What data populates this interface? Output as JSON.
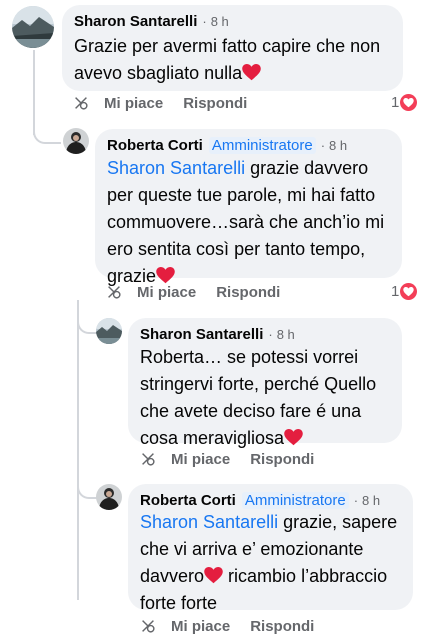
{
  "comments": [
    {
      "author": "Sharon Santarelli",
      "badge": "",
      "time": "8 h",
      "text": "Grazie per avermi fatto capire che non avevo sbagliato nulla",
      "actions": {
        "like": "Mi piace",
        "reply": "Rispondi"
      },
      "reactions": "1",
      "avatar_icon": "landscape-photo-avatar"
    },
    {
      "author": "Roberta Corti",
      "badge": "Amministratore",
      "time": "8 h",
      "mention": "Sharon Santarelli",
      "text": " grazie davvero per queste tue parole, mi hai fatto commuovere…sarà che anch’io mi ero sentita così per tanto tempo, grazie",
      "actions": {
        "like": "Mi piace",
        "reply": "Rispondi"
      },
      "reactions": "1",
      "avatar_icon": "person-photo-avatar"
    },
    {
      "author": "Sharon Santarelli",
      "badge": "",
      "time": "8 h",
      "text": "Roberta… se potessi vorrei stringervi forte, perché Quello che avete deciso fare é una cosa meravigliosa",
      "actions": {
        "like": "Mi piace",
        "reply": "Rispondi"
      },
      "avatar_icon": "landscape-photo-avatar"
    },
    {
      "author": "Roberta Corti",
      "badge": "Amministratore",
      "time": "8 h",
      "mention": "Sharon Santarelli",
      "text_a": " grazie, sapere che vi arriva e’ emozionante davvero",
      "text_b": " ricambio l’abbraccio forte forte",
      "actions": {
        "like": "Mi piace",
        "reply": "Rispondi"
      },
      "avatar_icon": "person-photo-avatar"
    }
  ],
  "colors": {
    "bubble": "#f0f2f5",
    "link": "#1877f2",
    "meta": "#65676b",
    "heart": "#e41e3f"
  }
}
